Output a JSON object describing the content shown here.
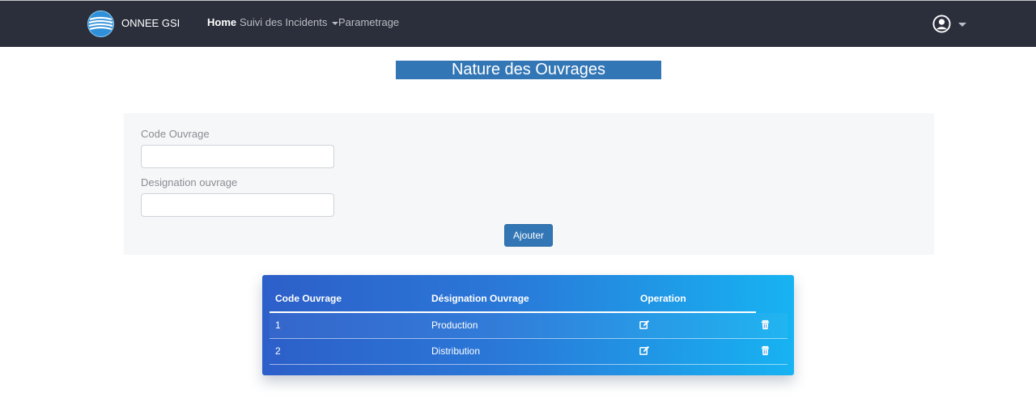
{
  "navbar": {
    "brand": "ONNEE GSI",
    "links": [
      {
        "label": "Home",
        "active": true
      },
      {
        "label": "Suivi des Incidents",
        "dropdown": true
      },
      {
        "label": "Parametrage"
      }
    ],
    "user_icon": "user-circle-icon"
  },
  "page": {
    "title": "Nature des Ouvrages"
  },
  "form": {
    "code_label": "Code Ouvrage",
    "code_value": "",
    "designation_label": "Designation ouvrage",
    "designation_value": "",
    "add_button": "Ajouter"
  },
  "table": {
    "headers": [
      "Code Ouvrage",
      "Désignation Ouvrage",
      "Operation"
    ],
    "rows": [
      {
        "code": "1",
        "designation": "Production"
      },
      {
        "code": "2",
        "designation": "Distribution"
      }
    ],
    "edit_icon": "edit-icon",
    "delete_icon": "trash-icon"
  },
  "colors": {
    "navbar_bg": "#2b2f3b",
    "accent": "#3276b5",
    "table_gradient_start": "#2d5fc9",
    "table_gradient_end": "#17b3f2"
  }
}
